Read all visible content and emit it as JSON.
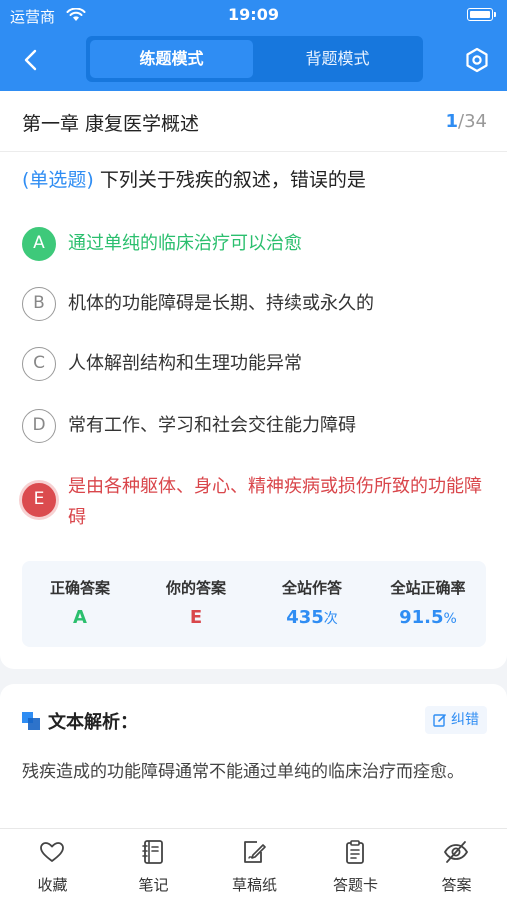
{
  "status_bar": {
    "carrier": "运营商",
    "time": "19:09"
  },
  "header": {
    "tabs": [
      {
        "label": "练题模式",
        "active": true
      },
      {
        "label": "背题模式",
        "active": false
      }
    ],
    "icons": {
      "back": "chevron-left-icon",
      "settings": "hexagon-settings-icon"
    }
  },
  "question_card": {
    "chapter_title": "第一章 康复医学概述",
    "progress": {
      "current": "1",
      "total": "/34"
    },
    "question": {
      "type": "(单选题)",
      "text": "下列关于残疾的叙述，错误的是"
    },
    "options": [
      {
        "letter": "A",
        "text": "通过单纯的临床治疗可以治愈",
        "state": "correct"
      },
      {
        "letter": "B",
        "text": "机体的功能障碍是长期、持续或永久的",
        "state": "normal"
      },
      {
        "letter": "C",
        "text": "人体解剖结构和生理功能异常",
        "state": "normal"
      },
      {
        "letter": "D",
        "text": "常有工作、学习和社会交往能力障碍",
        "state": "normal"
      },
      {
        "letter": "E",
        "text": "是由各种躯体、身心、精神疾病或损伤所致的功能障碍",
        "state": "wrong"
      }
    ],
    "stats": {
      "correct_answer": {
        "label": "正确答案",
        "value": "A"
      },
      "your_answer": {
        "label": "你的答案",
        "value": "E"
      },
      "site_attempts": {
        "label": "全站作答",
        "value": "435",
        "unit": "次"
      },
      "site_accuracy": {
        "label": "全站正确率",
        "value": "91.5",
        "unit": "%"
      }
    },
    "colors": {
      "correct": "#2bbf6e",
      "wrong": "#d9464b",
      "accent": "#2f8df3"
    }
  },
  "analysis": {
    "title": "文本解析：",
    "report_button": "纠错",
    "text": "残疾造成的功能障碍通常不能通过单纯的临床治疗而痊愈。"
  },
  "bottom_nav": [
    {
      "label": "收藏",
      "icon": "heart-icon"
    },
    {
      "label": "笔记",
      "icon": "notebook-icon"
    },
    {
      "label": "草稿纸",
      "icon": "draft-pen-icon"
    },
    {
      "label": "答题卡",
      "icon": "clipboard-icon"
    },
    {
      "label": "答案",
      "icon": "eye-off-icon"
    }
  ]
}
